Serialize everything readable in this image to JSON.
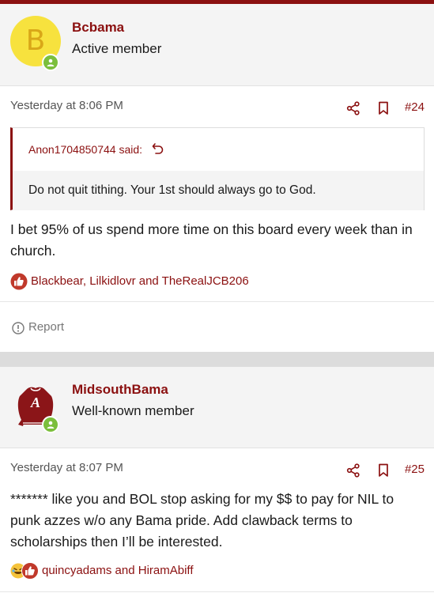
{
  "colors": {
    "accent": "#8b1010",
    "online": "#7bbf3c",
    "avatar_bg": "#f7e23e"
  },
  "posts": [
    {
      "author": "Bcbama",
      "avatar_letter": "B",
      "user_title": "Active member",
      "date": "Yesterday at 8:06 PM",
      "post_number": "#24",
      "quote": {
        "author_label": "Anon1704850744 said:",
        "text": "Do not quit tithing. Your 1st should always go to God."
      },
      "message": "I bet 95% of us spend more time on this board every week than in church.",
      "reactions": "Blackbear, Lilkidlovr and TheRealJCB206",
      "report_label": "Report"
    },
    {
      "author": "MidsouthBama",
      "user_title": "Well-known member",
      "date": "Yesterday at 8:07 PM",
      "post_number": "#25",
      "message": "******* like you and BOL stop asking for my $$ to pay for NIL to punk azzes w/o any Bama pride. Add clawback terms to scholarships then I’ll be interested.",
      "reactions": "quincyadams and HiramAbiff"
    }
  ]
}
